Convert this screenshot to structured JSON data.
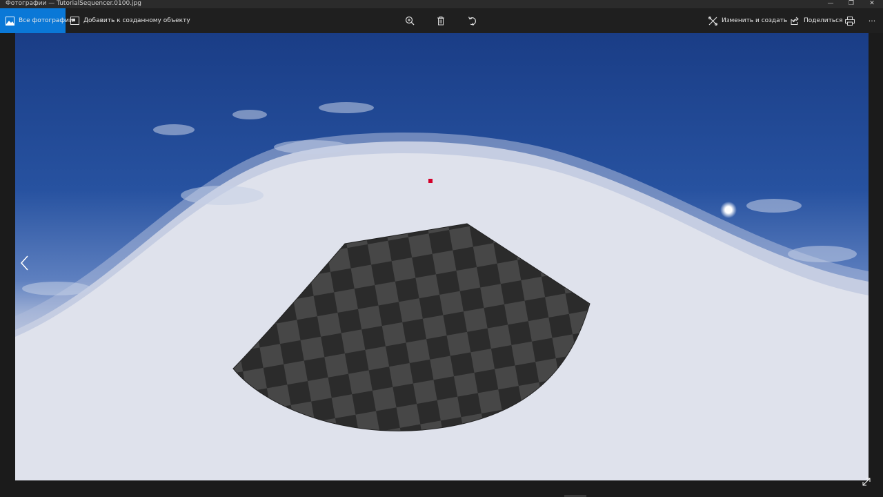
{
  "window": {
    "title": "Фотографии — TutorialSequencer.0100.jpg",
    "controls": {
      "minimize": "—",
      "maximize": "❐",
      "close": "✕"
    }
  },
  "toolbar": {
    "all_photos_label": "Все фотографии",
    "add_to_creation_label": "Добавить к созданному объекту",
    "edit_create_label": "Изменить и создать",
    "share_label": "Поделиться",
    "more_label": "···",
    "icons": [
      "photos-icon",
      "add-to-creation-icon",
      "zoom-icon",
      "delete-icon",
      "rotate-icon",
      "edit-create-icon",
      "chevron-down-icon",
      "share-icon",
      "print-icon",
      "more-icon"
    ]
  },
  "colors": {
    "accent": "#0a78d7",
    "toolbar_bg": "#1f1f1f",
    "sky_top": "#1e3f86",
    "horizon": "#d9dce8",
    "checker_dark": "#2c2c2c",
    "checker_light": "#474747",
    "marker": "#d4002a"
  }
}
